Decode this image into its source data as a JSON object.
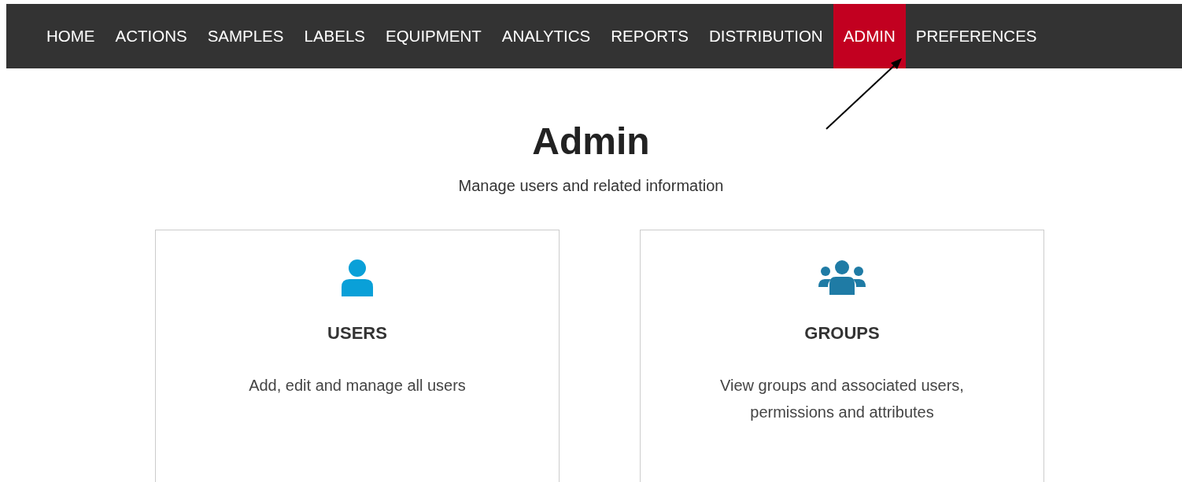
{
  "nav": [
    {
      "label": "HOME",
      "selected": false
    },
    {
      "label": "ACTIONS",
      "selected": false
    },
    {
      "label": "SAMPLES",
      "selected": false
    },
    {
      "label": "LABELS",
      "selected": false
    },
    {
      "label": "EQUIPMENT",
      "selected": false
    },
    {
      "label": "ANALYTICS",
      "selected": false
    },
    {
      "label": "REPORTS",
      "selected": false
    },
    {
      "label": "DISTRIBUTION",
      "selected": false
    },
    {
      "label": "ADMIN",
      "selected": true
    },
    {
      "label": "PREFERENCES",
      "selected": false
    }
  ],
  "page": {
    "title": "Admin",
    "subtitle": "Manage users and related information"
  },
  "cards": [
    {
      "kind": "user",
      "title": "USERS",
      "description": "Add, edit and manage all users"
    },
    {
      "kind": "group",
      "title": "GROUPS",
      "description": "View groups and associated users, permissions and attributes"
    }
  ]
}
